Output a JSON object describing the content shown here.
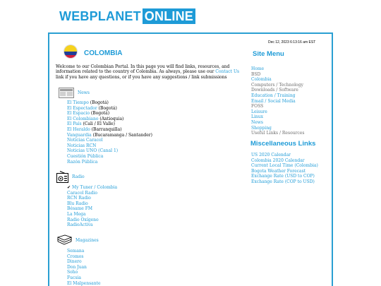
{
  "logo": {
    "part1": "WEBPLANET",
    "part2": "ONLINE"
  },
  "timestamp": "Dec 12, 2023 6:13:16 am EST",
  "page": {
    "title": "COLOMBIA",
    "intro_before": "Welcome to our Colombian Portal.  In this page you will find links, resources, and information related to the country of Colombia.  As always, please use our ",
    "intro_link": "Contact Us",
    "intro_after": " link if you have any questions, or if you have any suggestions / link submissions"
  },
  "news": {
    "heading": "News",
    "icon": "newspaper-icon",
    "items": [
      {
        "label": "El Tiempo",
        "sub": " (Bogotá)"
      },
      {
        "label": "El Espectador",
        "sub": " (Bogotá)"
      },
      {
        "label": "El Espacio",
        "sub": " (Bogotá)"
      },
      {
        "label": "El Colombiano",
        "sub": " (Antioquia)"
      },
      {
        "label": "El País",
        "sub": " (Cali / El Valle)"
      },
      {
        "label": "El Heraldo",
        "sub": " (Barranquilla)"
      },
      {
        "label": "Vanguardia",
        "sub": " (Bucaramanga / Santander)"
      },
      {
        "label": "Noticias Caracol",
        "sub": ""
      },
      {
        "label": "Noticias RCN",
        "sub": ""
      },
      {
        "label": "Noticias UNO (Canal 1)",
        "sub": ""
      },
      {
        "label": "Cuestión Pública",
        "sub": ""
      },
      {
        "label": "Razón Pública",
        "sub": ""
      }
    ]
  },
  "radio": {
    "heading": "Radio",
    "icon": "radio-icon",
    "items": [
      {
        "label": "My Tuner / Colombia",
        "bullet": "✔ "
      },
      {
        "label": "Caracol Radio"
      },
      {
        "label": "RCN Radio"
      },
      {
        "label": "Blu Radio"
      },
      {
        "label": "Bésame FM"
      },
      {
        "label": "La Mega"
      },
      {
        "label": "Radio Oxígeno"
      },
      {
        "label": "RadioActiva"
      }
    ]
  },
  "magazines": {
    "heading": "Magazines",
    "icon": "magazine-icon",
    "items": [
      {
        "label": "Semana"
      },
      {
        "label": "Cromos"
      },
      {
        "label": "Dinero"
      },
      {
        "label": "Don Juan"
      },
      {
        "label": "Soho"
      },
      {
        "label": "Fucsia"
      },
      {
        "label": "El Malpensante"
      }
    ]
  },
  "site_menu": {
    "heading": "Site Menu",
    "items": [
      {
        "label": "Home",
        "muted": false
      },
      {
        "label": "BSD",
        "muted": true
      },
      {
        "label": "Colombia",
        "muted": false
      },
      {
        "label": "Computers / Technology",
        "muted": true
      },
      {
        "label": "Downloads / Software",
        "muted": true
      },
      {
        "label": "Education / Training",
        "muted": false
      },
      {
        "label": "Email / Social Media",
        "muted": false
      },
      {
        "label": "FOSS",
        "muted": true
      },
      {
        "label": "Leisure",
        "muted": false
      },
      {
        "label": "Linux",
        "muted": false
      },
      {
        "label": "News",
        "muted": false
      },
      {
        "label": "Shopping",
        "muted": false
      },
      {
        "label": "Useful Links / Resources",
        "muted": true
      }
    ]
  },
  "misc_links": {
    "heading": "Miscellaneous Links",
    "items": [
      {
        "label": "US 2020 Calendar"
      },
      {
        "label": "Colombia 2020 Calendar"
      },
      {
        "label": "Current Local Time (Colombia)"
      },
      {
        "label": "Bogota Weather Forecast"
      },
      {
        "label": "Exchange Rate (USD to COP)"
      },
      {
        "label": "Exchange Rate (COP to USD)"
      }
    ]
  },
  "colors": {
    "accent": "#1e9bd7",
    "border": "#2a9fd2",
    "muted": "#6b6b6b"
  }
}
